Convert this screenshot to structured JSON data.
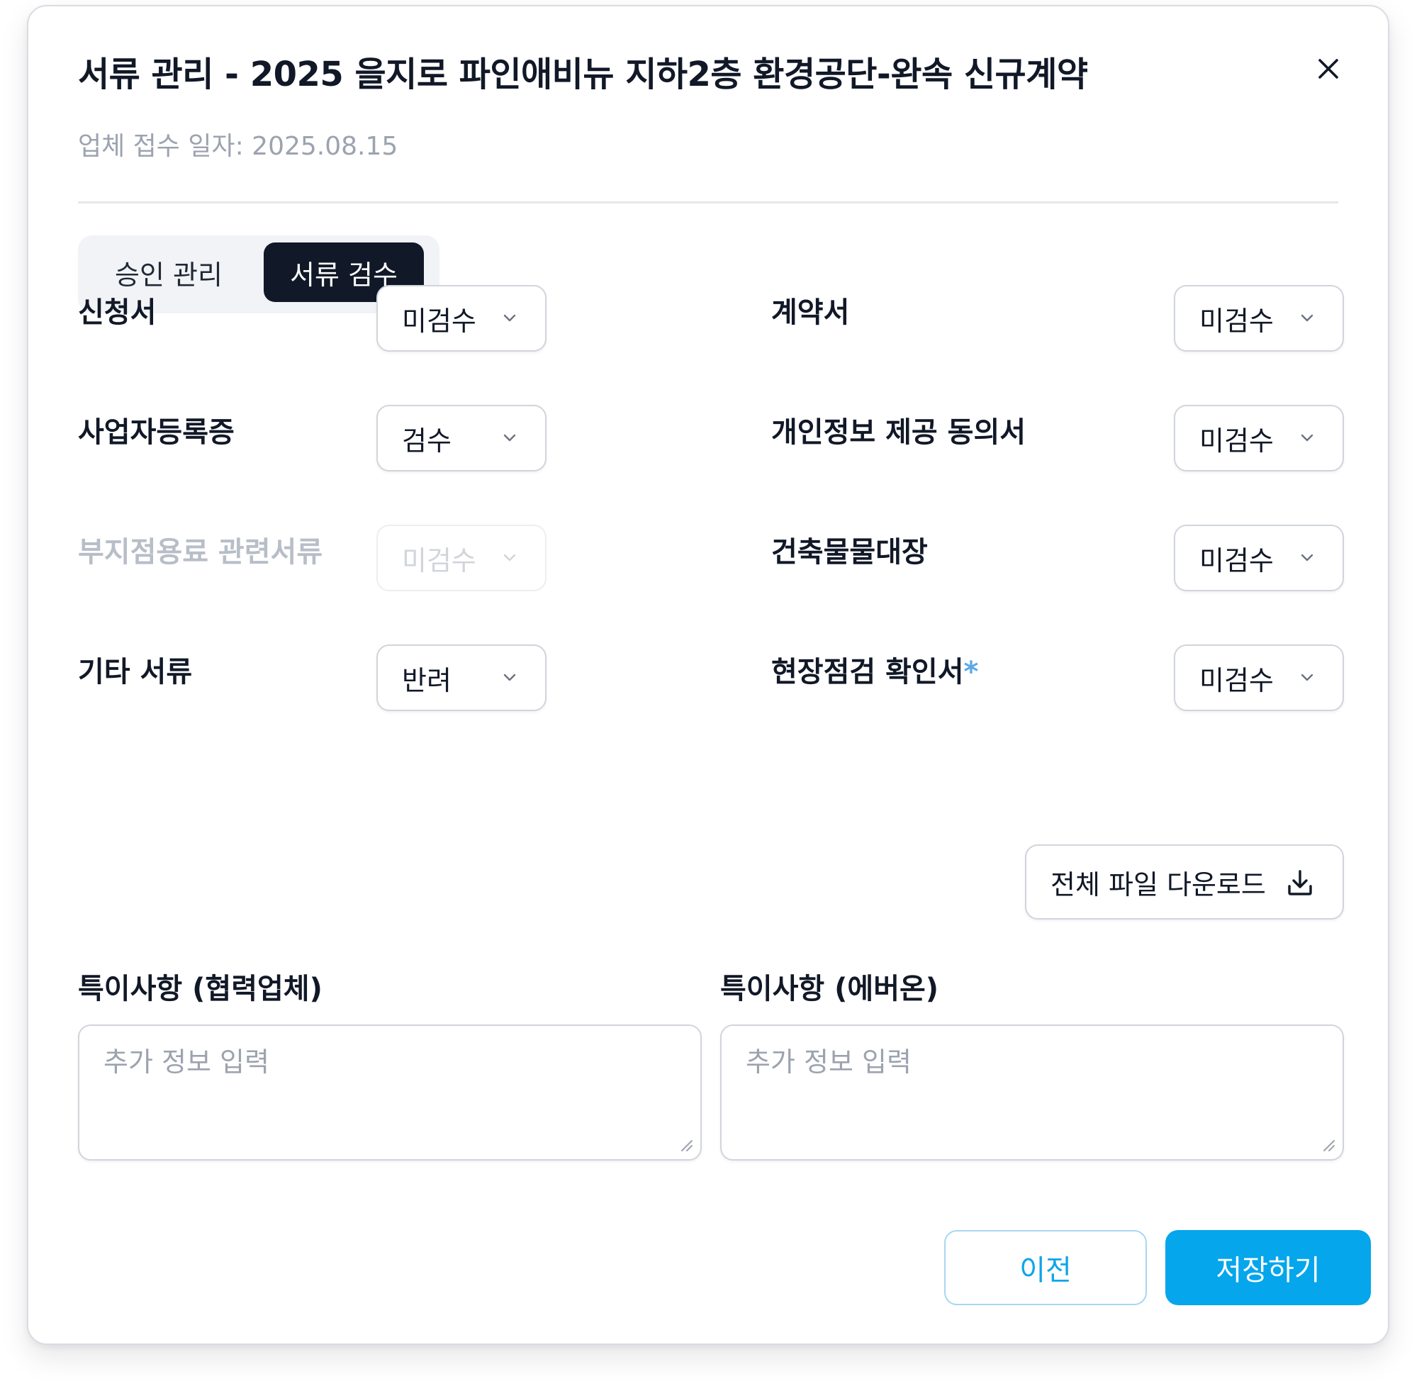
{
  "dialog": {
    "title": "서류 관리 - 2025 을지로 파인애비뉴 지하2층 환경공단-완속 신규계약",
    "subtitle": "업체 접수 일자: 2025.08.15",
    "close_icon": "close-icon"
  },
  "tabs": [
    {
      "label": "승인 관리",
      "active": false
    },
    {
      "label": "서류 검수",
      "active": true
    }
  ],
  "documents": {
    "left": [
      {
        "label": "신청서",
        "status": "미검수",
        "disabled": false
      },
      {
        "label": "사업자등록증",
        "status": "검수",
        "disabled": false
      },
      {
        "label": "부지점용료 관련서류",
        "status": "미검수",
        "disabled": true
      },
      {
        "label": "기타 서류",
        "status": "반려",
        "disabled": false
      }
    ],
    "right": [
      {
        "label": "계약서",
        "status": "미검수",
        "disabled": false
      },
      {
        "label": "개인정보 제공 동의서",
        "status": "미검수",
        "disabled": false
      },
      {
        "label": "건축물물대장",
        "status": "미검수",
        "disabled": false
      },
      {
        "label": "현장점검 확인서",
        "required_mark": "*",
        "status": "미검수",
        "disabled": false
      }
    ]
  },
  "download": {
    "label": "전체 파일 다운로드",
    "icon": "download-icon"
  },
  "notes": [
    {
      "label": "특이사항 (협력업체)",
      "placeholder": "추가 정보 입력",
      "value": ""
    },
    {
      "label": "특이사항 (에버온)",
      "placeholder": "추가 정보 입력",
      "value": ""
    }
  ],
  "footer": {
    "prev_label": "이전",
    "save_label": "저장하기"
  },
  "colors": {
    "primary": "#05a6ec",
    "primary_text": "#0ea5e9",
    "tab_active_bg": "#111827",
    "required_star": "#5aa9e6",
    "muted_text": "#9ca3af"
  }
}
